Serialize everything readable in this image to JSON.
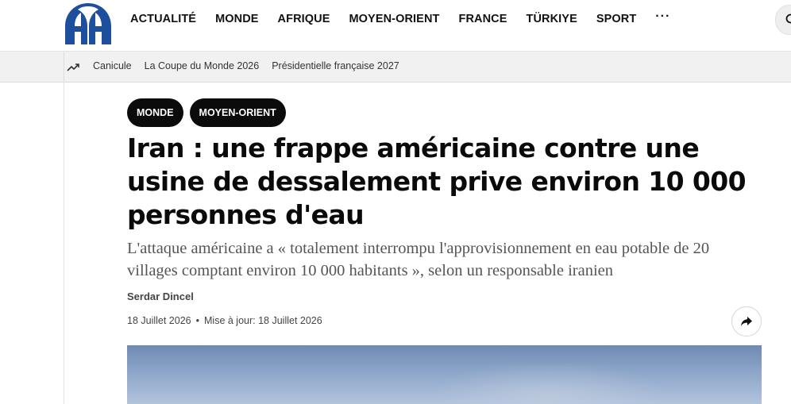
{
  "header": {
    "logo_text": "AA",
    "nav": [
      "ACTUALITÉ",
      "MONDE",
      "AFRIQUE",
      "MOYEN-ORIENT",
      "FRANCE",
      "TÜRKIYE",
      "SPORT"
    ],
    "more": "···"
  },
  "trending": {
    "icon": "trending-up-icon",
    "links": [
      "Canicule",
      "La Coupe du Monde 2026",
      "Présidentielle française 2027"
    ]
  },
  "article": {
    "tags": [
      "MONDE",
      "MOYEN-ORIENT"
    ],
    "title": "Iran : une frappe américaine contre une usine de dessalement prive environ 10 000 personnes d'eau",
    "lead": "L'attaque américaine a « totalement interrompu l'approvisionnement en eau potable de 20 villages comptant environ 10 000 habitants », selon un responsable iranien",
    "author": "Serdar Dincel",
    "date": "18 Juillet 2026",
    "separator": "•",
    "updated": "Mise à jour: 18 Juillet 2026"
  },
  "colors": {
    "tag_bg": "#0b0b0b",
    "logo_blue": "#1d4f9c",
    "strip_bg": "#f1f1f1"
  }
}
